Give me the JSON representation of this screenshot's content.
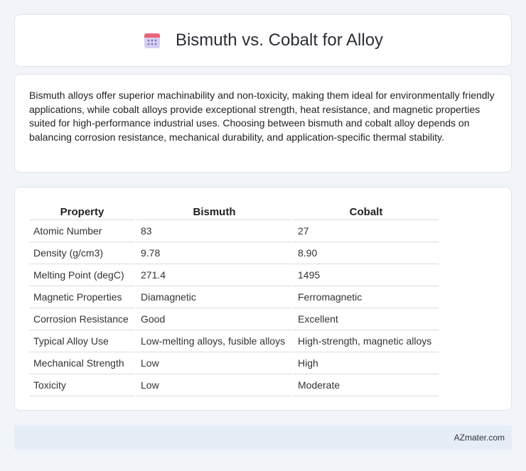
{
  "header": {
    "title": "Bismuth vs. Cobalt for Alloy",
    "icon": "calendar-icon",
    "icon_colors": {
      "top": "#e8647a",
      "body": "#c8c1ea",
      "dots": "#7f74c9"
    }
  },
  "summary": {
    "text": "Bismuth alloys offer superior machinability and non-toxicity, making them ideal for environmentally friendly applications, while cobalt alloys provide exceptional strength, heat resistance, and magnetic properties suited for high-performance industrial uses. Choosing between bismuth and cobalt alloy depends on balancing corrosion resistance, mechanical durability, and application-specific thermal stability."
  },
  "table": {
    "headers": [
      "Property",
      "Bismuth",
      "Cobalt"
    ],
    "rows": [
      [
        "Atomic Number",
        "83",
        "27"
      ],
      [
        "Density (g/cm3)",
        "9.78",
        "8.90"
      ],
      [
        "Melting Point (degC)",
        "271.4",
        "1495"
      ],
      [
        "Magnetic Properties",
        "Diamagnetic",
        "Ferromagnetic"
      ],
      [
        "Corrosion Resistance",
        "Good",
        "Excellent"
      ],
      [
        "Typical Alloy Use",
        "Low-melting alloys, fusible alloys",
        "High-strength, magnetic alloys"
      ],
      [
        "Mechanical Strength",
        "Low",
        "High"
      ],
      [
        "Toxicity",
        "Low",
        "Moderate"
      ]
    ]
  },
  "footer": {
    "brand": "AZmater.com"
  }
}
